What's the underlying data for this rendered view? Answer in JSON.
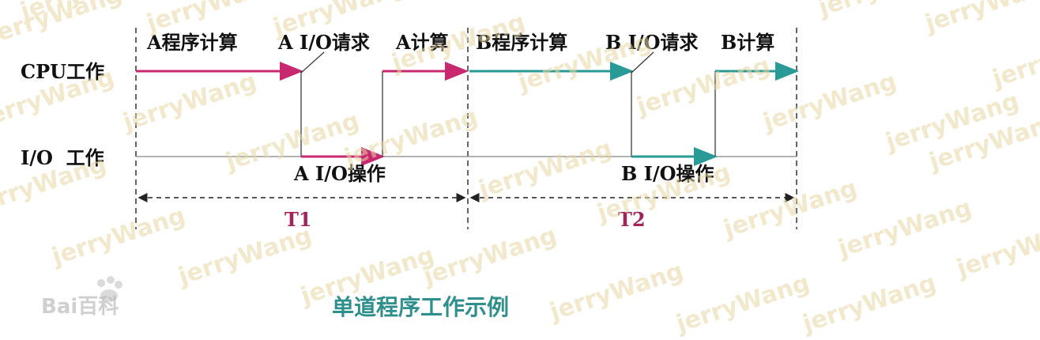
{
  "watermark": "jerryWang",
  "rows": {
    "cpu": "CPU工作",
    "io": "I/O  工作"
  },
  "cpu_labels": [
    "A程序计算",
    "A I/O请求",
    "A计算",
    "B程序计算",
    "B I/O请求",
    "B计算"
  ],
  "io_labels": [
    "A I/O操作",
    "B I/O操作"
  ],
  "periods": [
    "T1",
    "T2"
  ],
  "caption": "单道程序工作示例",
  "logo": "Bai百科",
  "colors": {
    "program_a": "#c8286e",
    "program_b": "#2a9a96",
    "baseline": "#9a9a9a",
    "period_text": "#a0245c",
    "caption": "#2f8f8c"
  }
}
